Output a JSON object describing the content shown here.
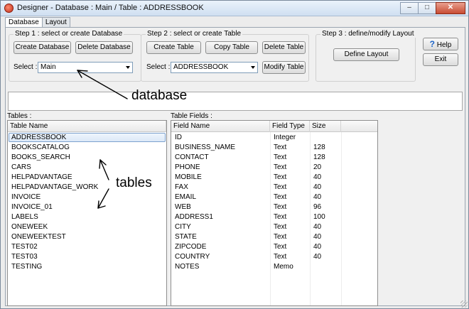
{
  "window": {
    "title": "Designer - Database : Main / Table : ADDRESSBOOK"
  },
  "controls": {
    "minimize": "–",
    "maximize": "□",
    "close": "✕"
  },
  "tabs": [
    {
      "label": "Database"
    },
    {
      "label": "Layout"
    }
  ],
  "step1": {
    "legend": "Step 1 : select or create Database",
    "create_label": "Create Database",
    "delete_label": "Delete Database",
    "select_label": "Select :",
    "selected": "Main"
  },
  "step2": {
    "legend": "Step 2 : select or create Table",
    "create_label": "Create Table",
    "copy_label": "Copy Table",
    "delete_label": "Delete Table",
    "select_label": "Select :",
    "selected": "ADDRESSBOOK",
    "modify_label": "Modify Table"
  },
  "step3": {
    "legend": "Step 3 : define/modify Layout",
    "define_label": "Define Layout"
  },
  "side": {
    "help_label": "Help",
    "help_icon": "?",
    "exit_label": "Exit"
  },
  "tables": {
    "label": "Tables :",
    "header": "Table Name",
    "rows": [
      "ADDRESSBOOK",
      "BOOKSCATALOG",
      "BOOKS_SEARCH",
      "CARS",
      "HELPADVANTAGE",
      "HELPADVANTAGE_WORK",
      "INVOICE",
      "INVOICE_01",
      "LABELS",
      "ONEWEEK",
      "ONEWEEKTEST",
      "TEST02",
      "TEST03",
      "TESTING"
    ]
  },
  "fields": {
    "label": "Table Fields :",
    "headers": [
      "Field Name",
      "Field Type",
      "Size"
    ],
    "rows": [
      [
        "ID",
        "Integer",
        ""
      ],
      [
        "BUSINESS_NAME",
        "Text",
        "128"
      ],
      [
        "CONTACT",
        "Text",
        "128"
      ],
      [
        "PHONE",
        "Text",
        "20"
      ],
      [
        "MOBILE",
        "Text",
        "40"
      ],
      [
        "FAX",
        "Text",
        "40"
      ],
      [
        "EMAIL",
        "Text",
        "40"
      ],
      [
        "WEB",
        "Text",
        "96"
      ],
      [
        "ADDRESS1",
        "Text",
        "100"
      ],
      [
        "CITY",
        "Text",
        "40"
      ],
      [
        "STATE",
        "Text",
        "40"
      ],
      [
        "ZIPCODE",
        "Text",
        "40"
      ],
      [
        "COUNTRY",
        "Text",
        "40"
      ],
      [
        "NOTES",
        "Memo",
        ""
      ]
    ]
  },
  "annotations": {
    "database": "database",
    "tables": "tables"
  },
  "colors": {
    "selection": "#dbe8f7",
    "accent": "#1c64c8"
  }
}
